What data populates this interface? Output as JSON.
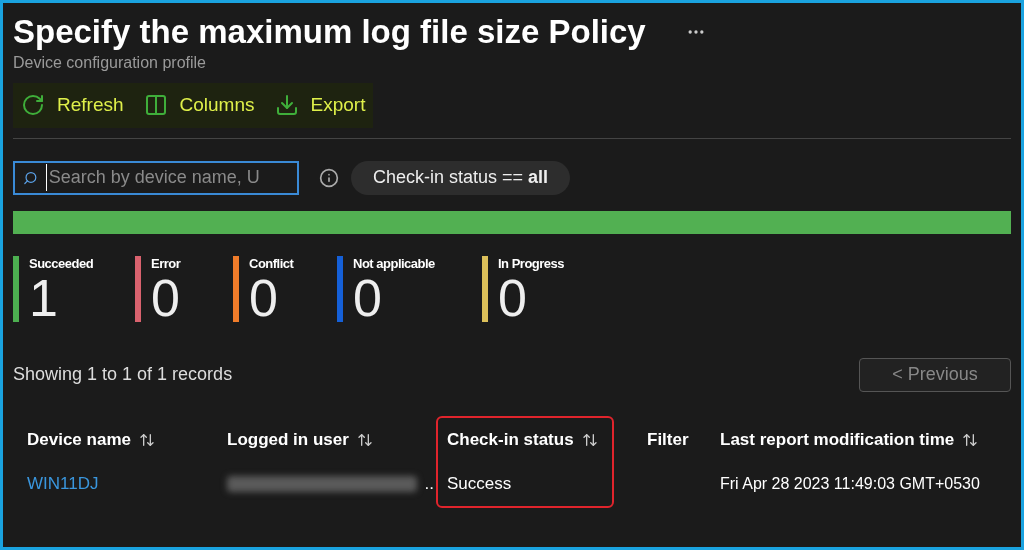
{
  "header": {
    "title": "Specify the maximum log file size Policy",
    "subtitle": "Device configuration profile"
  },
  "toolbar": [
    {
      "kind": "refresh",
      "label": "Refresh"
    },
    {
      "kind": "columns",
      "label": "Columns"
    },
    {
      "kind": "export",
      "label": "Export"
    }
  ],
  "search": {
    "placeholder": "Search by device name, U"
  },
  "filter_pill": "Check-in status == **all**",
  "status_bar": {
    "level": 1
  },
  "stats": [
    {
      "label": "Succeeded",
      "value": "1",
      "color": "#4caf50"
    },
    {
      "label": "Error",
      "value": "0",
      "color": "#d9626e"
    },
    {
      "label": "Conflict",
      "value": "0",
      "color": "#f07c2a"
    },
    {
      "label": "Not applicable",
      "value": "0",
      "color": "#1560d8"
    },
    {
      "label": "In Progress",
      "value": "0",
      "color": "#dcc05a"
    }
  ],
  "records_text": "Showing 1 to 1 of 1 records",
  "pagination": {
    "previous": {
      "label": "< Previous",
      "disabled": true
    }
  },
  "table": {
    "columns": [
      {
        "label": "Device name",
        "sortable": true,
        "highlighted": false
      },
      {
        "label": "Logged in user",
        "sortable": true,
        "highlighted": false
      },
      {
        "label": "Check-in status",
        "sortable": true,
        "highlighted": true
      },
      {
        "label": "Filter",
        "sortable": false,
        "highlighted": false
      },
      {
        "label": "Last report modification time",
        "sortable": true,
        "highlighted": false
      }
    ],
    "rows": [
      {
        "cells": [
          {
            "kind": "link",
            "text": "WIN11DJ"
          },
          {
            "kind": "blurred",
            "text": ".."
          },
          {
            "kind": "text",
            "text": "Success"
          },
          {
            "kind": "empty"
          },
          {
            "kind": "text",
            "text": "Fri Apr 28 2023 11:49:03 GMT+0530"
          }
        ]
      }
    ]
  }
}
